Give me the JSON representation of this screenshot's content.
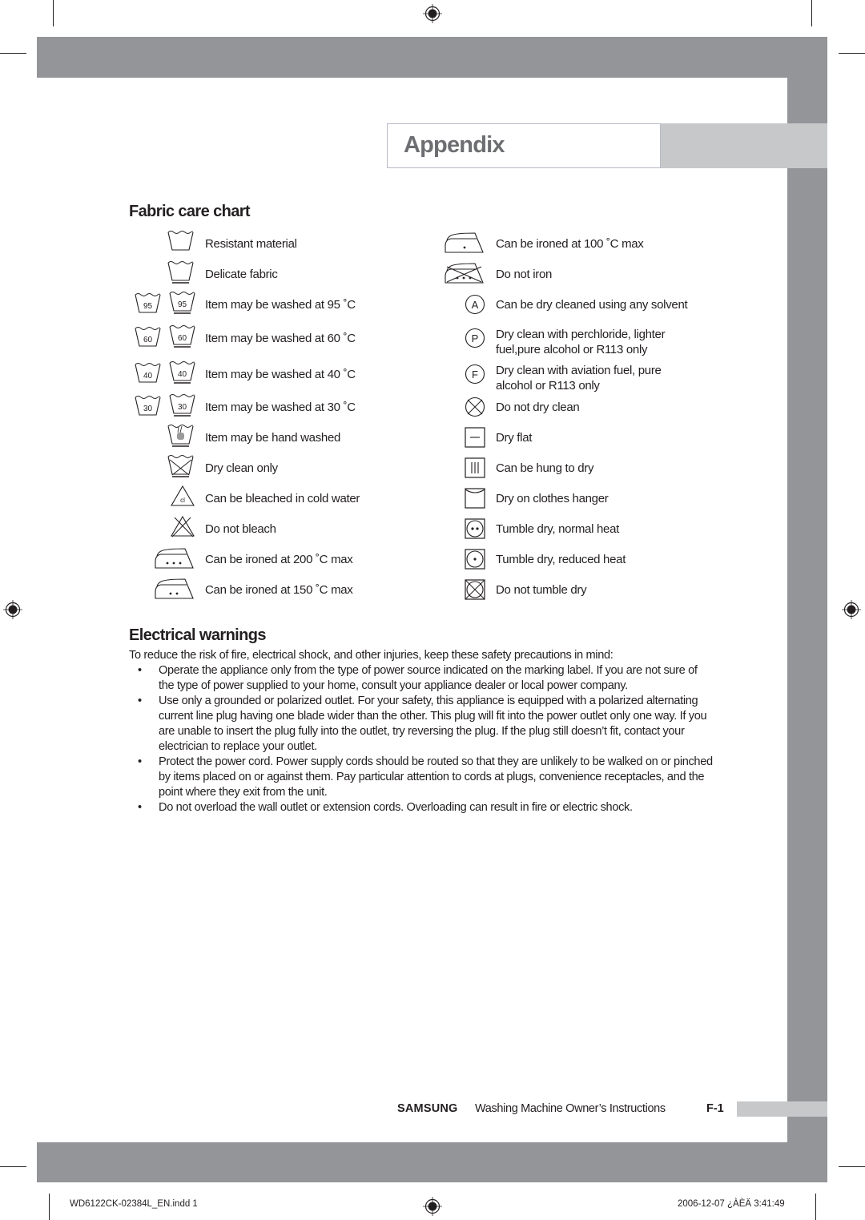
{
  "header": {
    "title": "Appendix"
  },
  "fabric_care": {
    "title": "Fabric care chart",
    "left": [
      {
        "icon": "wash-tub-icon",
        "label": "Resistant material"
      },
      {
        "icon": "wash-tub-delicate-icon",
        "label": "Delicate fabric"
      },
      {
        "icon": "wash-95-icon",
        "temp": "95",
        "label": "Item may be washed at 95 ˚C"
      },
      {
        "icon": "wash-60-icon",
        "temp": "60",
        "label": "Item may be washed at 60 ˚C"
      },
      {
        "icon": "wash-40-icon",
        "temp": "40",
        "label": "Item may be washed at 40 ˚C"
      },
      {
        "icon": "wash-30-icon",
        "temp": "30",
        "label": "Item may be washed at 30 ˚C"
      },
      {
        "icon": "hand-wash-icon",
        "label": "Item may be hand washed"
      },
      {
        "icon": "do-not-wash-icon",
        "label": "Dry clean only"
      },
      {
        "icon": "bleach-triangle-icon",
        "glyph": "cl",
        "label": "Can be bleached in cold water"
      },
      {
        "icon": "do-not-bleach-icon",
        "label": "Do not bleach"
      },
      {
        "icon": "iron-three-dots-icon",
        "label": "Can be ironed at 200 ˚C max"
      },
      {
        "icon": "iron-two-dots-icon",
        "label": "Can be ironed at 150 ˚C max"
      }
    ],
    "right": [
      {
        "icon": "iron-one-dot-icon",
        "label": "Can be ironed at 100 ˚C max"
      },
      {
        "icon": "do-not-iron-icon",
        "label": "Do not iron"
      },
      {
        "icon": "dry-clean-a-icon",
        "glyph": "A",
        "label": "Can be dry cleaned using any solvent"
      },
      {
        "icon": "dry-clean-p-icon",
        "glyph": "P",
        "label": "Dry clean with perchloride, lighter",
        "label2": "fuel,pure alcohol or R113 only"
      },
      {
        "icon": "dry-clean-f-icon",
        "glyph": "F",
        "label": "Dry clean with aviation fuel, pure",
        "label2": "alcohol or R113 only"
      },
      {
        "icon": "do-not-dry-clean-icon",
        "label": "Do not dry clean"
      },
      {
        "icon": "dry-flat-icon",
        "label": "Dry flat"
      },
      {
        "icon": "hang-dry-icon",
        "label": "Can be hung to dry"
      },
      {
        "icon": "clothes-hanger-dry-icon",
        "label": "Dry on clothes hanger"
      },
      {
        "icon": "tumble-dry-normal-icon",
        "label": "Tumble dry, normal heat"
      },
      {
        "icon": "tumble-dry-reduced-icon",
        "label": "Tumble dry, reduced heat"
      },
      {
        "icon": "do-not-tumble-dry-icon",
        "label": "Do not tumble dry"
      }
    ]
  },
  "electrical": {
    "title": "Electrical warnings",
    "intro": "To reduce the risk of fire, electrical shock, and other injuries, keep these safety precautions in mind:",
    "bullet": "•",
    "items": [
      "Operate the appliance only from the type of power source indicated on the marking label. If you are not sure of the type of power supplied to your home, consult your appliance dealer or local power company.",
      "Use only a grounded or polarized outlet. For your safety, this appliance is equipped with a polarized alternating current line plug having one blade wider than the other. This plug will fit into the power outlet only one way. If you are unable to insert the plug fully into the outlet, try reversing the plug. If the plug still doesn’t fit, contact your electrician to replace your outlet.",
      "Protect the power cord. Power supply cords should be routed so that they are unlikely to be walked on or pinched by items placed on or against them. Pay particular attention to cords at plugs, convenience receptacles, and the point where they exit from the unit.",
      "Do not overload the wall outlet or extension cords. Overloading can result in fire or electric shock."
    ]
  },
  "footer": {
    "brand": "SAMSUNG",
    "doc_title": "Washing Machine Owner’s Instructions",
    "page": "F-1"
  },
  "print_slug": {
    "file": "WD6122CK-02384L_EN.indd   1",
    "timestamp": "2006-12-07   ¿ÀÈÄ 3:41:49"
  },
  "colors": {
    "band_gray": "#939598",
    "band_light": "#c7c8ca",
    "title_gray": "#6d6e71",
    "text": "#231f20"
  }
}
